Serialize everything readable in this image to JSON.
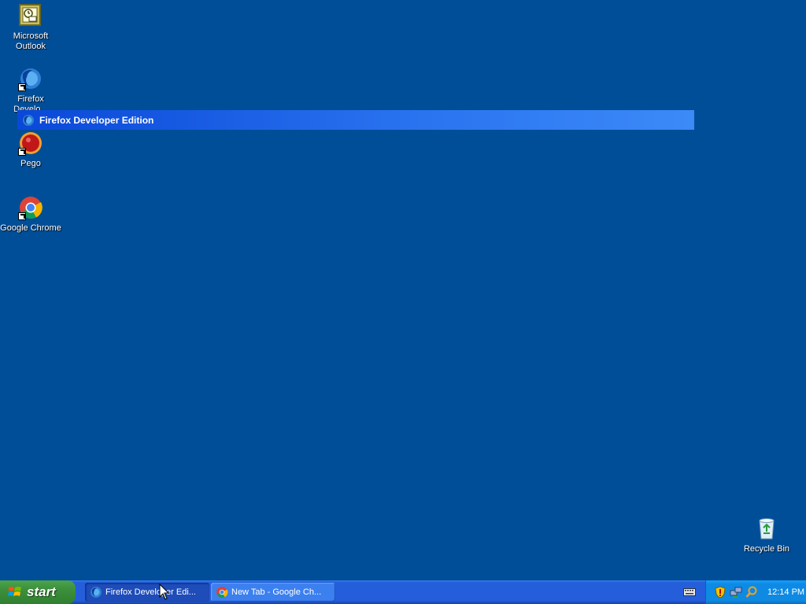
{
  "desktop": {
    "background_color": "#004e98",
    "icons": [
      {
        "label": "Microsoft Outlook",
        "icon": "outlook-icon"
      },
      {
        "label": "Firefox Develo...",
        "icon": "firefox-developer-icon"
      },
      {
        "label": "Pego",
        "icon": "pego-icon"
      },
      {
        "label": "Google Chrome",
        "icon": "chrome-icon"
      },
      {
        "label": "Recycle Bin",
        "icon": "recycle-bin-icon"
      }
    ]
  },
  "dragging_window": {
    "title": "Firefox Developer Edition",
    "icon": "firefox-developer-icon"
  },
  "taskbar": {
    "start_label": "start",
    "buttons": [
      {
        "label": "Firefox Developer Edi...",
        "icon": "firefox-developer-icon",
        "active": true
      },
      {
        "label": "New Tab - Google Ch...",
        "icon": "chrome-icon",
        "active": false
      }
    ],
    "tray": {
      "icons": [
        "security-shield-icon",
        "network-icon",
        "search-icon"
      ],
      "clock": "12:14 PM"
    },
    "keyboard_icon": "keyboard-icon"
  }
}
